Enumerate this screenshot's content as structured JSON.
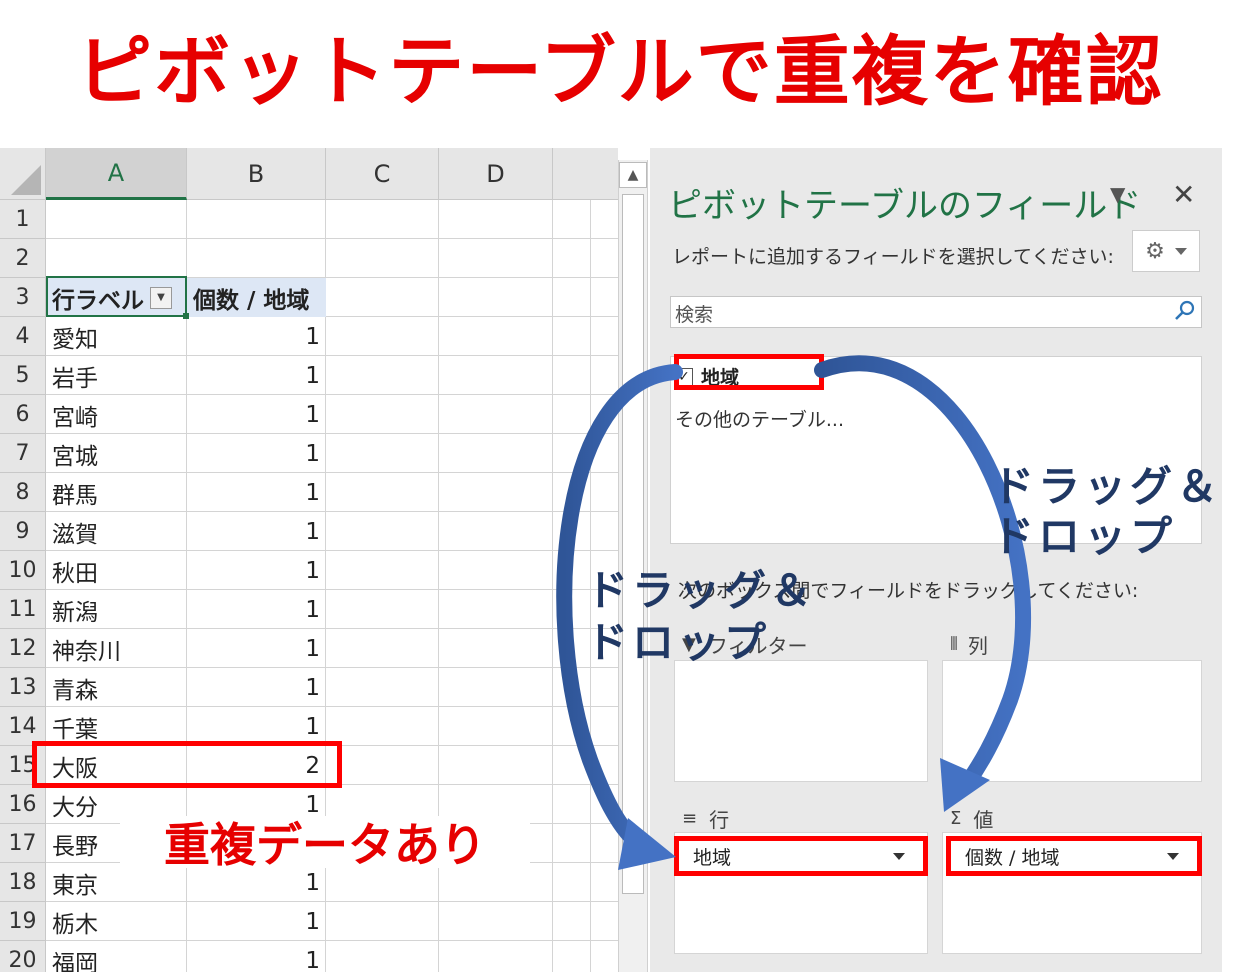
{
  "title": "ピボットテーブルで重複を確認",
  "sheet": {
    "columns": [
      "A",
      "B",
      "C",
      "D"
    ],
    "header_row": {
      "row": "3",
      "label": "行ラベル",
      "value": "個数 / 地域"
    },
    "rows": [
      {
        "row": "1",
        "label": "",
        "value": ""
      },
      {
        "row": "2",
        "label": "",
        "value": ""
      },
      {
        "row": "4",
        "label": "愛知",
        "value": "1"
      },
      {
        "row": "5",
        "label": "岩手",
        "value": "1"
      },
      {
        "row": "6",
        "label": "宮崎",
        "value": "1"
      },
      {
        "row": "7",
        "label": "宮城",
        "value": "1"
      },
      {
        "row": "8",
        "label": "群馬",
        "value": "1"
      },
      {
        "row": "9",
        "label": "滋賀",
        "value": "1"
      },
      {
        "row": "10",
        "label": "秋田",
        "value": "1"
      },
      {
        "row": "11",
        "label": "新潟",
        "value": "1"
      },
      {
        "row": "12",
        "label": "神奈川",
        "value": "1"
      },
      {
        "row": "13",
        "label": "青森",
        "value": "1"
      },
      {
        "row": "14",
        "label": "千葉",
        "value": "1"
      },
      {
        "row": "15",
        "label": "大阪",
        "value": "2"
      },
      {
        "row": "16",
        "label": "大分",
        "value": "1"
      },
      {
        "row": "17",
        "label": "長野",
        "value": "1"
      },
      {
        "row": "18",
        "label": "東京",
        "value": "1"
      },
      {
        "row": "19",
        "label": "栃木",
        "value": "1"
      },
      {
        "row": "20",
        "label": "福岡",
        "value": "1"
      }
    ]
  },
  "pane": {
    "title": "ピボットテーブルのフィールド",
    "subtitle": "レポートに追加するフィールドを選択してください:",
    "search_placeholder": "検索",
    "field_name": "地域",
    "field_checked": true,
    "more_tables": "その他のテーブル...",
    "drag_hint": "次のボックス間でフィールドをドラッグしてください:",
    "areas": {
      "filter": "フィルター",
      "columns": "列",
      "rows": "行",
      "values": "値"
    },
    "rows_item": "地域",
    "values_item": "個数 / 地域"
  },
  "annotations": {
    "duplicate_label": "重複データあり",
    "drag_drop_1a": "ドラッグ＆",
    "drag_drop_1b": "ドロップ",
    "drag_drop_2a": "ドラッグ＆",
    "drag_drop_2b": "ドロップ"
  },
  "colors": {
    "title_red": "#e60000",
    "highlight_red": "#ff0000",
    "excel_green": "#217346",
    "arrow_blue": "#4472c4",
    "annotation_navy": "#203864"
  }
}
